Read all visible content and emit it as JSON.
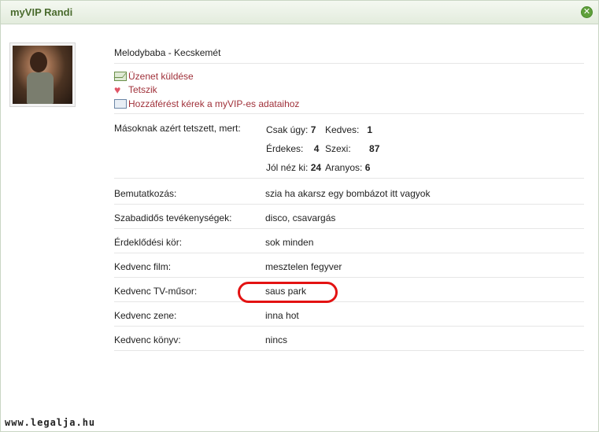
{
  "window": {
    "title": "myVIP Randi",
    "close_icon": "close-icon"
  },
  "profile": {
    "name_line": "Melodybaba - Kecskemét"
  },
  "actions": [
    {
      "label": "Üzenet küldése",
      "icon": "mail-icon"
    },
    {
      "label": "Tetszik",
      "icon": "heart-icon"
    },
    {
      "label": "Hozzáférést kérek a myVIP-es adataihoz",
      "icon": "id-card-icon"
    }
  ],
  "likes": {
    "label": "Másoknak azért tetszett, mert:",
    "traits": [
      {
        "name": "Csak úgy:",
        "count": "7"
      },
      {
        "name": "Kedves:",
        "count": "1"
      },
      {
        "name": "Érdekes:",
        "count": "4"
      },
      {
        "name": "Szexi:",
        "count": "87"
      },
      {
        "name": "Jól néz ki:",
        "count": "24"
      },
      {
        "name": "Aranyos:",
        "count": "6"
      }
    ]
  },
  "fields": [
    {
      "label": "Bemutatkozás:",
      "value": "szia ha akarsz egy bombázot itt vagyok"
    },
    {
      "label": "Szabadidős tevékenységek:",
      "value": "disco, csavargás"
    },
    {
      "label": "Érdeklődési kör:",
      "value": "sok minden"
    },
    {
      "label": "Kedvenc film:",
      "value": "mesztelen fegyver"
    },
    {
      "label": "Kedvenc TV-műsor:",
      "value": "saus park"
    },
    {
      "label": "Kedvenc zene:",
      "value": "inna hot"
    },
    {
      "label": "Kedvenc könyv:",
      "value": "nincs"
    }
  ],
  "watermark": "www.legalja.hu",
  "colors": {
    "accent_green": "#4a6b2e",
    "link_red": "#a0313a",
    "highlight_red": "#e31212"
  }
}
